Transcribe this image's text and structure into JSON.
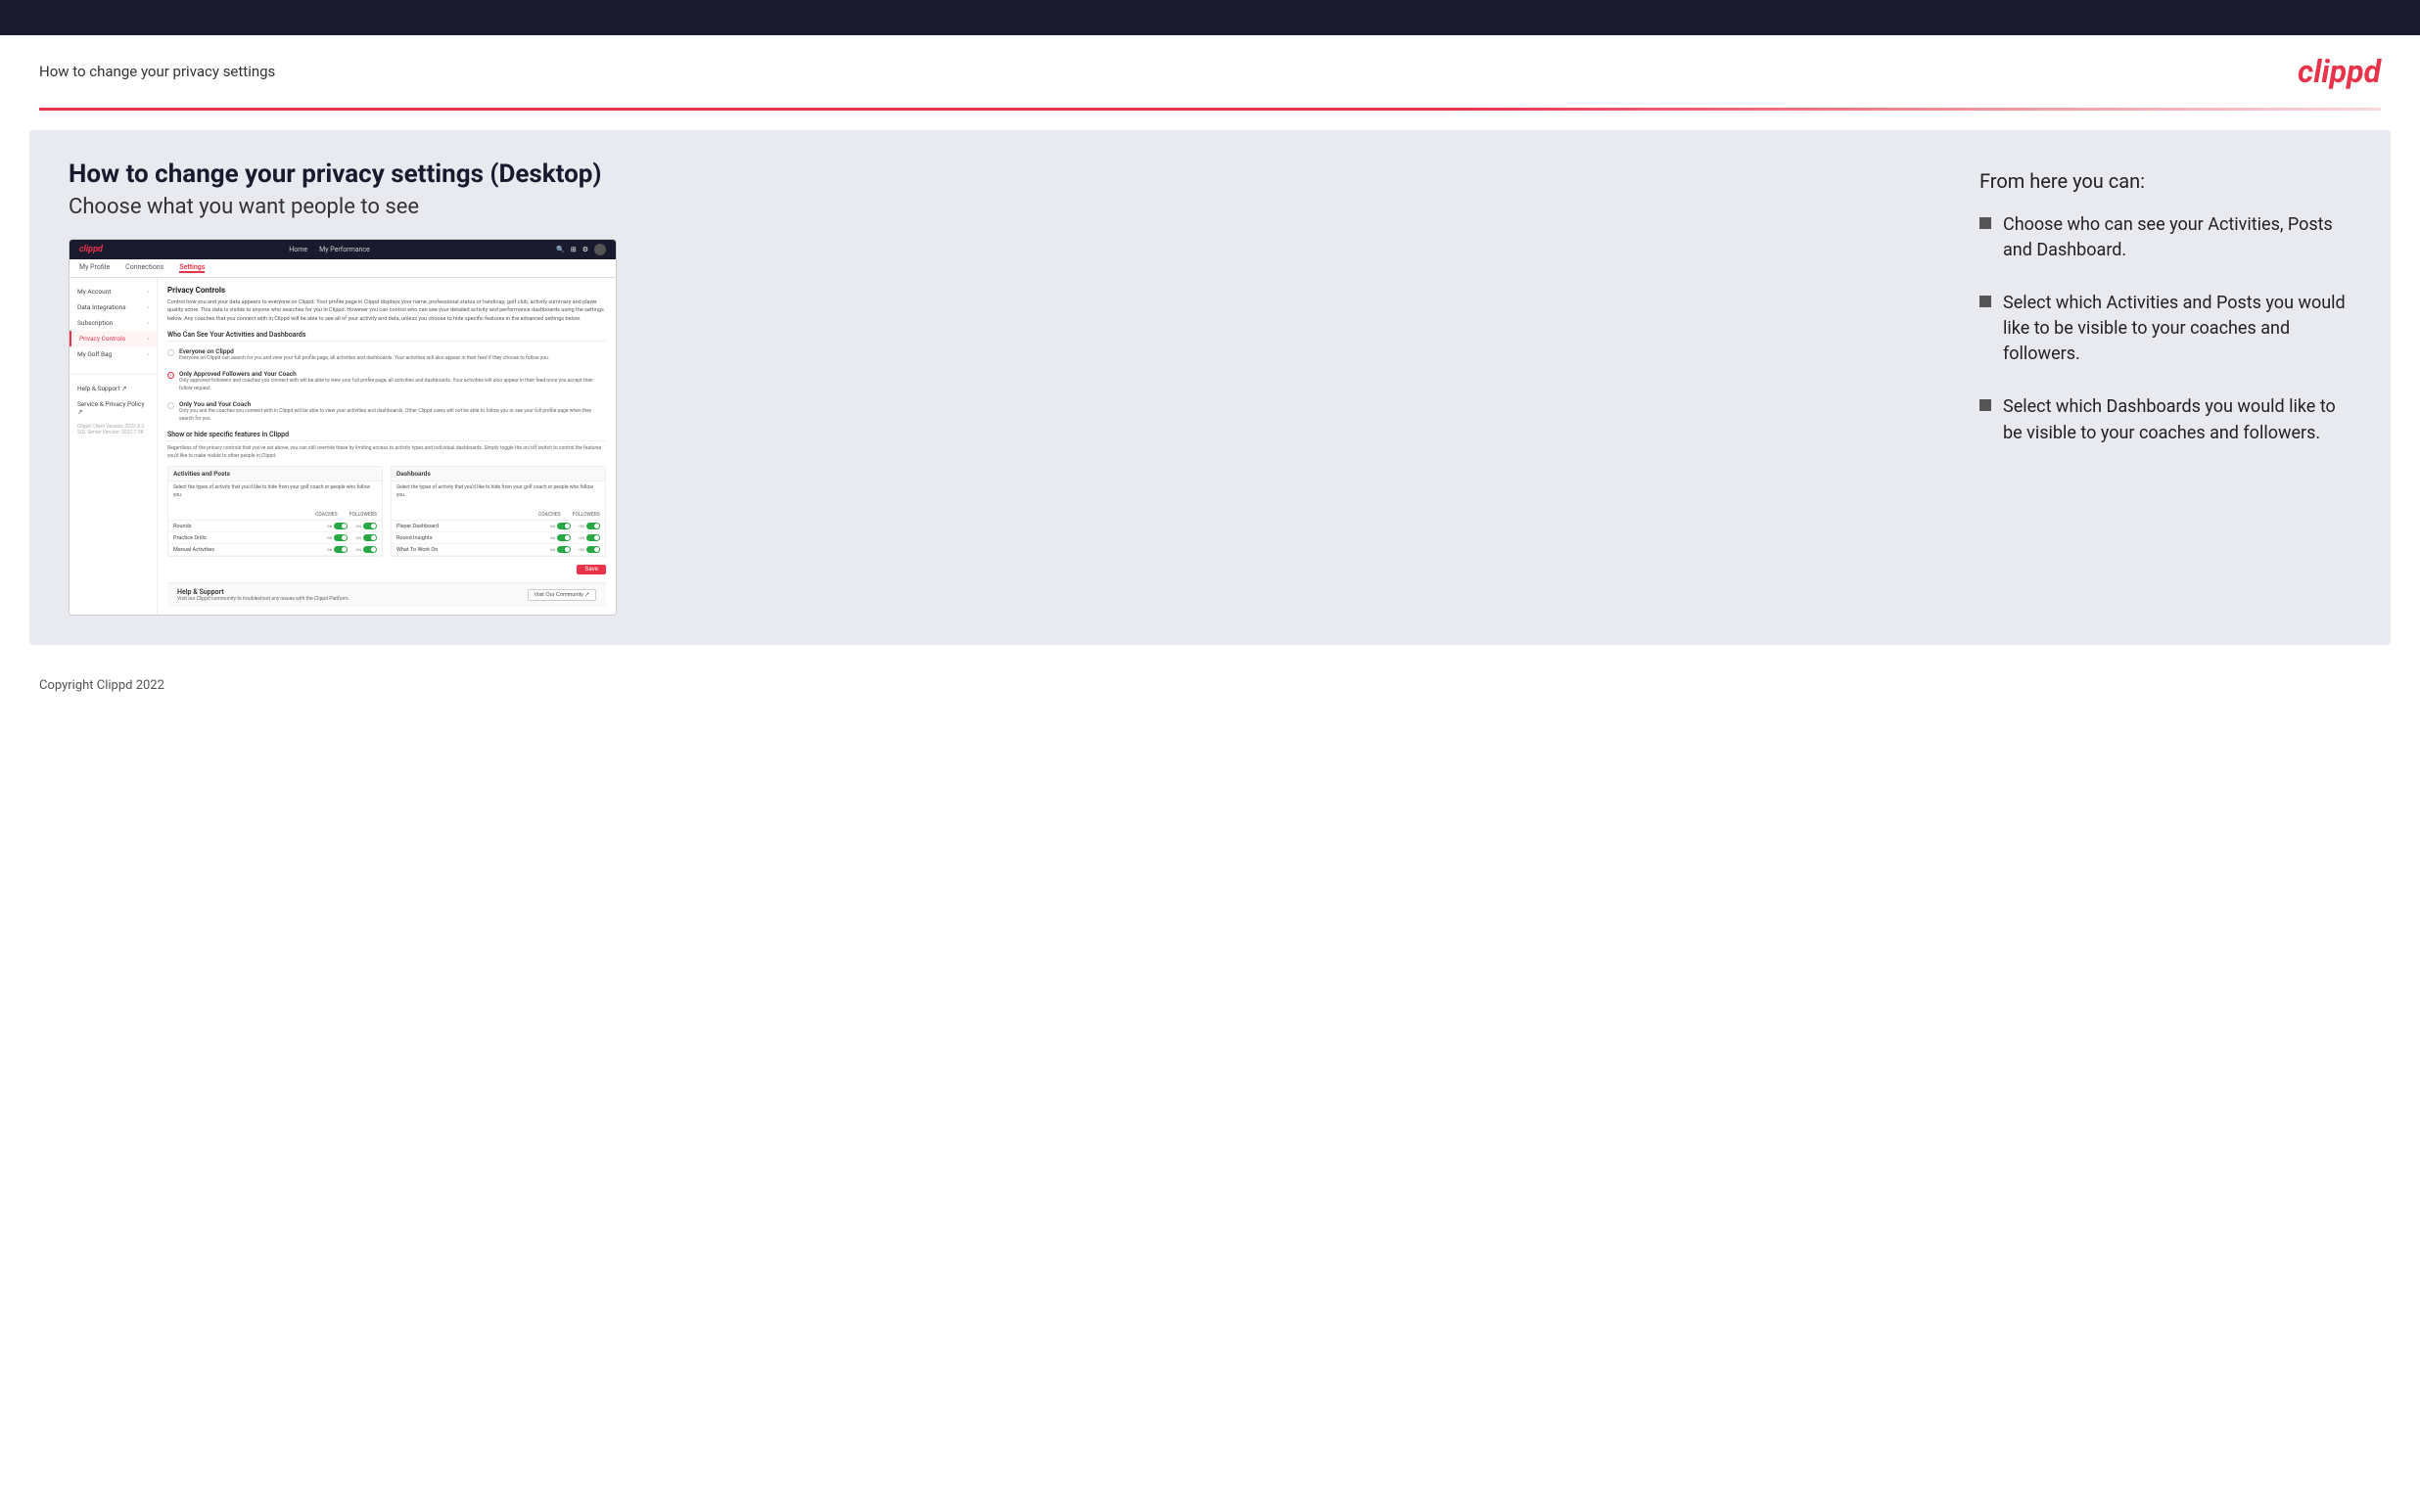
{
  "topbar": {
    "background": "#1a1a2e"
  },
  "header": {
    "title": "How to change your privacy settings",
    "logo": "clippd"
  },
  "main": {
    "heading": "How to change your privacy settings (Desktop)",
    "subheading": "Choose what you want people to see",
    "screenshot": {
      "topnav": {
        "logo": "clippd",
        "links": [
          "Home",
          "My Performance"
        ]
      },
      "subnav": [
        "My Profile",
        "Connections",
        "Settings"
      ],
      "subnav_active": "Settings",
      "sidebar": {
        "items": [
          {
            "label": "My Account",
            "active": false
          },
          {
            "label": "Data Integrations",
            "active": false
          },
          {
            "label": "Subscription",
            "active": false
          },
          {
            "label": "Privacy Controls",
            "active": true
          },
          {
            "label": "My Golf Bag",
            "active": false
          },
          {
            "label": "Help & Support",
            "active": false,
            "external": true
          },
          {
            "label": "Service & Privacy Policy",
            "active": false,
            "external": true
          }
        ],
        "version": "Clippd Client Version: 2022.8.2\nSQL Server Version: 2022.7.38"
      },
      "main_panel": {
        "section_title": "Privacy Controls",
        "section_desc": "Control how you and your data appears to everyone on Clippd. Your profile page in Clippd displays your name, professional status or handicap, golf club, activity summary and player quality score. This data is visible to anyone who searches for you in Clippd. However you can control who can see your detailed activity and performance dashboards using the settings below. Any coaches that you connect with in Clippd will be able to see all of your activity and data, unless you choose to hide specific features in the advanced settings below.",
        "who_title": "Who Can See Your Activities and Dashboards",
        "radio_options": [
          {
            "label": "Everyone on Clippd",
            "desc": "Everyone on Clippd can search for you and view your full profile page, all activities and dashboards. Your activities will also appear in their feed if they choose to follow you.",
            "selected": false
          },
          {
            "label": "Only Approved Followers and Your Coach",
            "desc": "Only approved followers and coaches you connect with will be able to view your full profile page, all activities and dashboards. Your activities will also appear in their feed once you accept their follow request.",
            "selected": true
          },
          {
            "label": "Only You and Your Coach",
            "desc": "Only you and the coaches you connect with in Clippd will be able to view your activities and dashboards. Other Clippd users will not be able to follow you or see your full profile page when they search for you.",
            "selected": false
          }
        ],
        "show_hide_title": "Show or hide specific features in Clippd",
        "show_hide_desc": "Regardless of the privacy controls that you've set above, you can still override these by limiting access to activity types and individual dashboards. Simply toggle the on/off switch to control the features you'd like to make visible to other people in Clippd.",
        "activities_table": {
          "title": "Activities and Posts",
          "desc": "Select the types of activity that you'd like to hide from your golf coach or people who follow you.",
          "col_headers": [
            "COACHES",
            "FOLLOWERS"
          ],
          "rows": [
            {
              "label": "Rounds",
              "coaches_on": true,
              "followers_on": true
            },
            {
              "label": "Practice Drills",
              "coaches_on": true,
              "followers_on": true
            },
            {
              "label": "Manual Activities",
              "coaches_on": true,
              "followers_on": true
            }
          ]
        },
        "dashboards_table": {
          "title": "Dashboards",
          "desc": "Select the types of activity that you'd like to hide from your golf coach or people who follow you.",
          "col_headers": [
            "COACHES",
            "FOLLOWERS"
          ],
          "rows": [
            {
              "label": "Player Dashboard",
              "coaches_on": true,
              "followers_on": true
            },
            {
              "label": "Round Insights",
              "coaches_on": true,
              "followers_on": true
            },
            {
              "label": "What To Work On",
              "coaches_on": true,
              "followers_on": true
            }
          ]
        },
        "save_button": "Save",
        "help": {
          "title": "Help & Support",
          "desc": "Visit our Clippd community to troubleshoot any issues with the Clippd Platform.",
          "button": "Visit Our Community"
        }
      }
    },
    "right_panel": {
      "from_here_title": "From here you can:",
      "bullets": [
        "Choose who can see your Activities, Posts and Dashboard.",
        "Select which Activities and Posts you would like to be visible to your coaches and followers.",
        "Select which Dashboards you would like to be visible to your coaches and followers."
      ]
    }
  },
  "footer": {
    "text": "Copyright Clippd 2022"
  }
}
